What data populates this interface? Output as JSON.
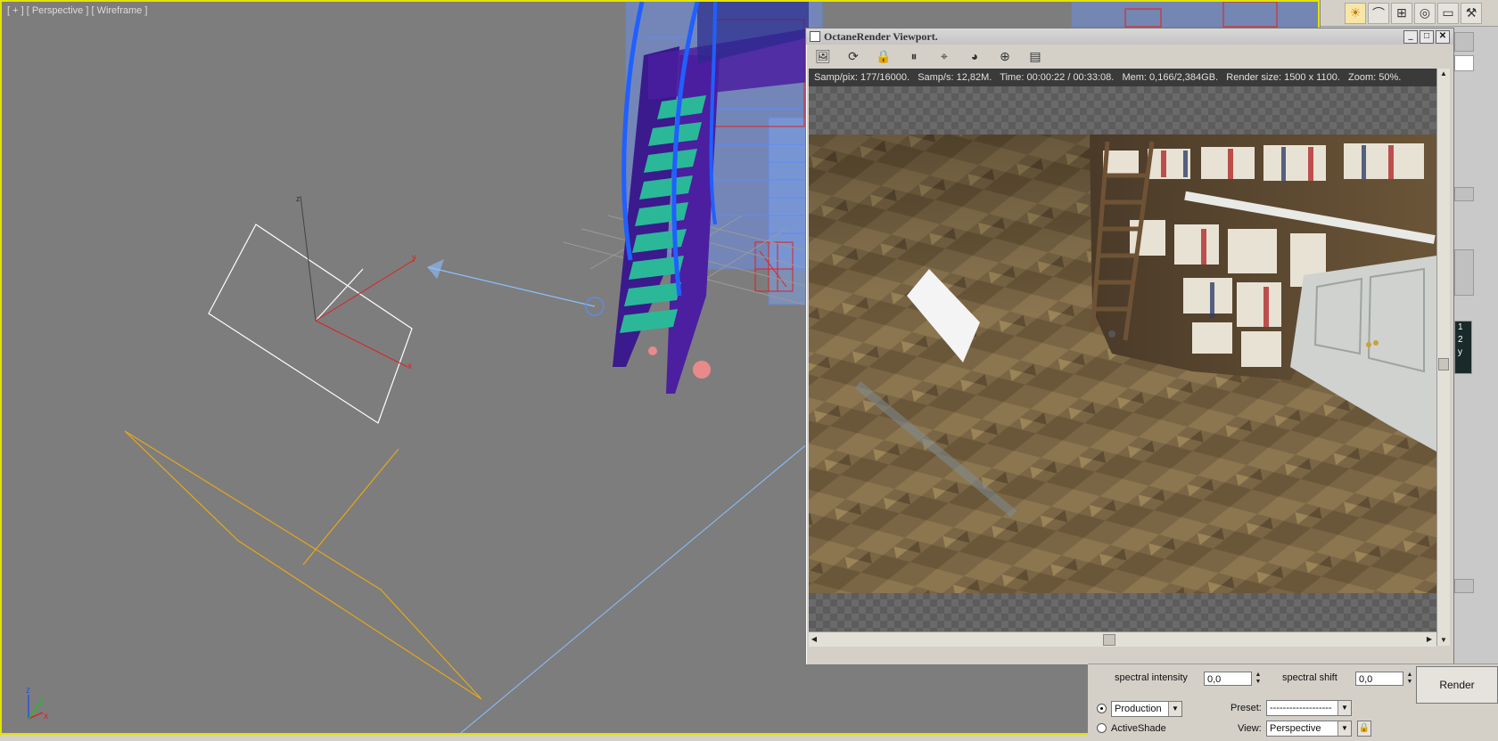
{
  "viewport": {
    "label": "[ + ] [ Perspective ] [ Wireframe ]",
    "gizmo_labels": {
      "y": "y",
      "x": "x",
      "z": "z"
    },
    "axis_tripod": {
      "x": "x",
      "y": "y",
      "z": "z"
    }
  },
  "octane_window": {
    "title": "OctaneRender Viewport.",
    "window_buttons": {
      "minimize": "_",
      "maximize": "□",
      "close": "✕"
    },
    "stats": "Samp/pix: 177/16000.   Samp/s: 12,82M.   Time: 00:00:22 / 00:33:08.   Mem: 0,166/2,384GB.   Render size: 1500 x 1100.   Zoom: 50%.",
    "toolbar_icons": [
      "picture-icon",
      "refresh-icon",
      "lock-icon",
      "pause-icon",
      "region-icon",
      "color-wheel-icon",
      "focus-target-icon",
      "settings-screen-icon"
    ]
  },
  "right_panel": {
    "toolbar_icons": [
      "sun-icon",
      "curve-icon",
      "hierarchy-icon",
      "motion-icon",
      "display-icon",
      "hammer-icon"
    ],
    "numbers": [
      "1",
      "2",
      "y"
    ]
  },
  "bottom_panel": {
    "spectral_intensity_label": "spectral intensity",
    "spectral_intensity_value": "0,0",
    "spectral_shift_label": "spectral shift",
    "spectral_shift_value": "0,0",
    "production_label": "Production",
    "activeshade_label": "ActiveShade",
    "preset_label": "Preset:",
    "preset_value": "-------------------",
    "view_label": "View:",
    "view_value": "Perspective",
    "render_label": "Render"
  },
  "colors": {
    "viewport_bg": "#7d7d7d",
    "active_border": "#e3e300",
    "stair_purple": "#4b1fa0",
    "stair_steps": "#2bb899",
    "wire_blue": "#3a82ff",
    "wire_red": "#e02020",
    "light_line": "#e6a817"
  }
}
